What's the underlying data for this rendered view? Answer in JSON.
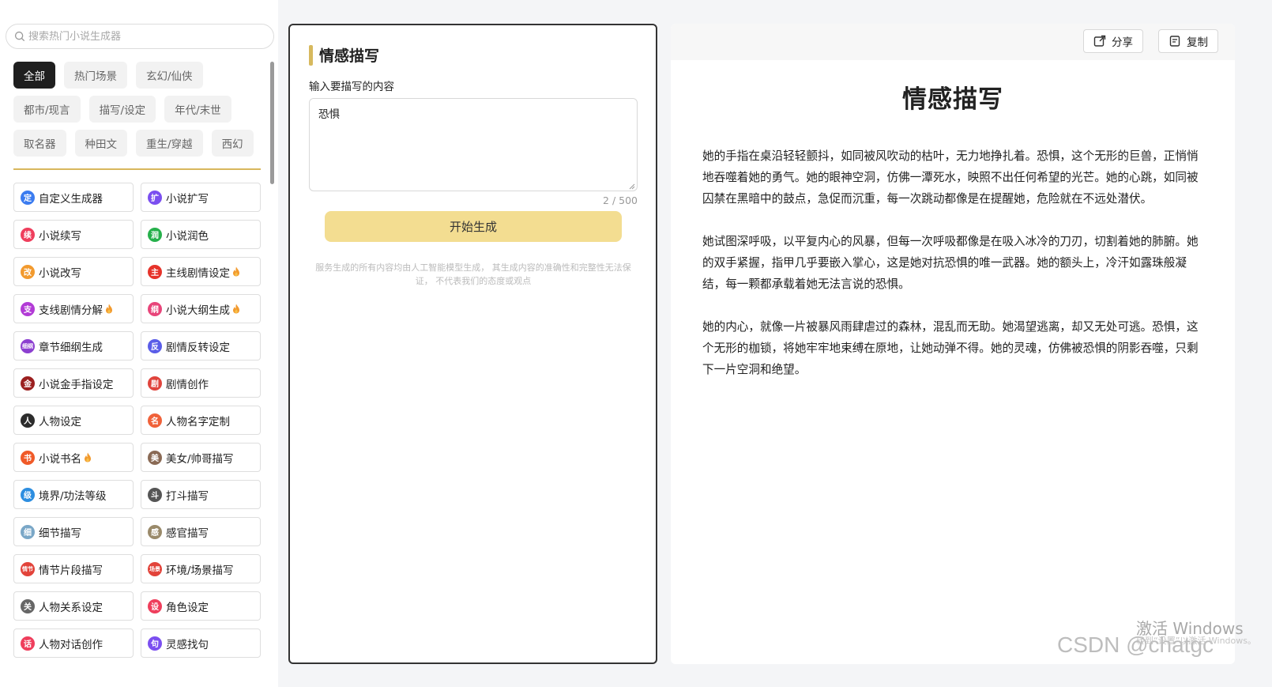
{
  "search": {
    "placeholder": "搜索热门小说生成器"
  },
  "categories": [
    [
      "全部",
      "热门场景",
      "玄幻/仙侠"
    ],
    [
      "都市/现言",
      "描写/设定",
      "年代/末世"
    ],
    [
      "取名器",
      "种田文",
      "重生/穿越",
      "西幻"
    ]
  ],
  "active_category": "全部",
  "tools": [
    {
      "label": "自定义生成器",
      "icon": "custom-icon",
      "glyph": "定",
      "color": "#3b7cf0",
      "hot": false
    },
    {
      "label": "小说扩写",
      "icon": "expand-icon",
      "glyph": "扩",
      "color": "#7b4ff0",
      "hot": false
    },
    {
      "label": "小说续写",
      "icon": "continue-icon",
      "glyph": "续",
      "color": "#ef3e5c",
      "hot": false
    },
    {
      "label": "小说润色",
      "icon": "polish-icon",
      "glyph": "润",
      "color": "#26b04b",
      "hot": false
    },
    {
      "label": "小说改写",
      "icon": "rewrite-icon",
      "glyph": "改",
      "color": "#f29a2e",
      "hot": false
    },
    {
      "label": "主线剧情设定",
      "icon": "mainline-icon",
      "glyph": "主",
      "color": "#e6332a",
      "hot": true
    },
    {
      "label": "支线剧情分解",
      "icon": "subplot-icon",
      "glyph": "支",
      "color": "#b23bd6",
      "hot": true
    },
    {
      "label": "小说大纲生成",
      "icon": "outline-icon",
      "glyph": "纲",
      "color": "#e8457a",
      "hot": true
    },
    {
      "label": "章节细纲生成",
      "icon": "chapter-icon",
      "glyph": "细纲",
      "color": "#8c3fd0",
      "hot": false
    },
    {
      "label": "剧情反转设定",
      "icon": "twist-icon",
      "glyph": "反",
      "color": "#5a5de8",
      "hot": false
    },
    {
      "label": "小说金手指设定",
      "icon": "cheat-icon",
      "glyph": "金",
      "color": "#9b1f1f",
      "hot": false
    },
    {
      "label": "剧情创作",
      "icon": "plot-icon",
      "glyph": "剧",
      "color": "#e0443c",
      "hot": false
    },
    {
      "label": "人物设定",
      "icon": "character-avatar-icon",
      "glyph": "人",
      "color": "#2c2c2c",
      "hot": false
    },
    {
      "label": "人物名字定制",
      "icon": "name-icon",
      "glyph": "名",
      "color": "#f0623a",
      "hot": false
    },
    {
      "label": "小说书名",
      "icon": "book-title-icon",
      "glyph": "书",
      "color": "#f05a28",
      "hot": true
    },
    {
      "label": "美女/帅哥描写",
      "icon": "portrait-icon",
      "glyph": "美",
      "color": "#8a6a55",
      "hot": false
    },
    {
      "label": "境界/功法等级",
      "icon": "level-icon",
      "glyph": "级",
      "color": "#2d8ee0",
      "hot": false
    },
    {
      "label": "打斗描写",
      "icon": "fight-icon",
      "glyph": "斗",
      "color": "#555555",
      "hot": false
    },
    {
      "label": "细节描写",
      "icon": "magnifier-icon",
      "glyph": "细",
      "color": "#7aa7c7",
      "hot": false
    },
    {
      "label": "感官描写",
      "icon": "senses-icon",
      "glyph": "感",
      "color": "#9a8a6a",
      "hot": false
    },
    {
      "label": "情节片段描写",
      "icon": "scene-fragment-icon",
      "glyph": "情节",
      "color": "#e2433a",
      "hot": false
    },
    {
      "label": "环境/场景描写",
      "icon": "environment-icon",
      "glyph": "场景",
      "color": "#e2433a",
      "hot": false
    },
    {
      "label": "人物关系设定",
      "icon": "relationship-icon",
      "glyph": "关",
      "color": "#666666",
      "hot": false
    },
    {
      "label": "角色设定",
      "icon": "role-icon",
      "glyph": "设",
      "color": "#ef3e5c",
      "hot": false
    },
    {
      "label": "人物对话创作",
      "icon": "dialogue-icon",
      "glyph": "话",
      "color": "#ef3e5c",
      "hot": false
    },
    {
      "label": "灵感找句",
      "icon": "inspiration-icon",
      "glyph": "句",
      "color": "#7b4ff0",
      "hot": false
    }
  ],
  "editor": {
    "title": "情感描写",
    "input_label": "输入要描写的内容",
    "input_value": "恐惧",
    "counter": "2 / 500",
    "generate_label": "开始生成",
    "disclaimer": "服务生成的所有内容均由人工智能模型生成， 其生成内容的准确性和完整性无法保证， 不代表我们的态度或观点"
  },
  "output": {
    "share_label": "分享",
    "copy_label": "复制",
    "title": "情感描写",
    "paragraphs": [
      "她的手指在桌沿轻轻颤抖，如同被风吹动的枯叶，无力地挣扎着。恐惧，这个无形的巨兽，正悄悄地吞噬着她的勇气。她的眼神空洞，仿佛一潭死水，映照不出任何希望的光芒。她的心跳，如同被囚禁在黑暗中的鼓点，急促而沉重，每一次跳动都像是在提醒她，危险就在不远处潜伏。",
      "她试图深呼吸，以平复内心的风暴，但每一次呼吸都像是在吸入冰冷的刀刃，切割着她的肺腑。她的双手紧握，指甲几乎要嵌入掌心，这是她对抗恐惧的唯一武器。她的额头上，冷汗如露珠般凝结，每一颗都承载着她无法言说的恐惧。",
      "她的内心，就像一片被暴风雨肆虐过的森林，混乱而无助。她渴望逃离，却又无处可逃。恐惧，这个无形的枷锁，将她牢牢地束缚在原地，让她动弹不得。她的灵魂，仿佛被恐惧的阴影吞噬，只剩下一片空洞和绝望。"
    ]
  },
  "watermarks": {
    "windows": "激活 Windows",
    "windows_sub": "转到“设置”以激活 Windows。",
    "csdn": "CSDN @chatgc"
  }
}
